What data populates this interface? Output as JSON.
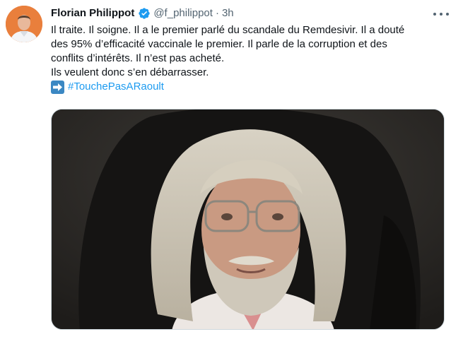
{
  "author": {
    "name": "Florian Philippot",
    "handle": "@f_philippot",
    "separator": "·",
    "time": "3h",
    "verified": true
  },
  "tweet": {
    "lines": [
      "Il traite. Il soigne. Il a le premier parlé du scandale du Remdesivir. Il a douté",
      "des 95% d’efficacité vaccinale le premier. Il parle de la corruption et des",
      "conflits d’intérêts. Il n’est pas acheté.",
      "Ils veulent donc s’en débarrasser."
    ],
    "hashtag_emoji": "right-arrow-emoji",
    "hashtag": "#TouchePasARaoult"
  },
  "colors": {
    "accent": "#1d9bf0",
    "text": "#0f1419",
    "secondary": "#536471",
    "border": "#cfd9de"
  },
  "icons": {
    "verified": "verified-badge-icon",
    "more": "more-options-icon"
  }
}
